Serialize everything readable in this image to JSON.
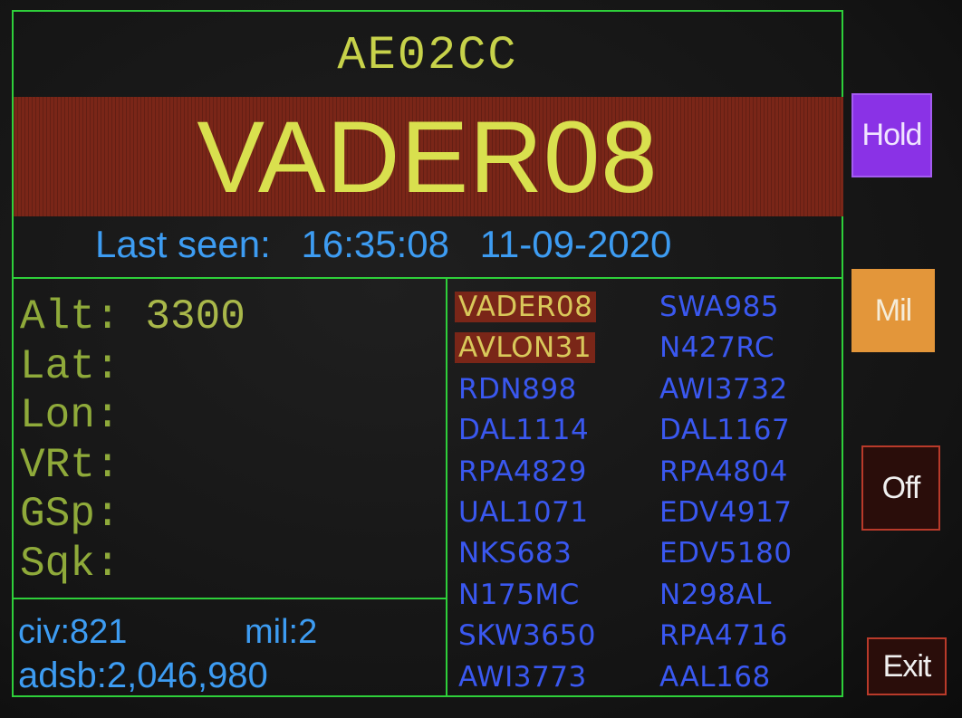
{
  "header": {
    "icao": "AE02CC",
    "callsign": "VADER08",
    "last_seen_label": "Last seen:",
    "last_seen_time": "16:35:08",
    "last_seen_date": "11-09-2020"
  },
  "stats": [
    {
      "label": "Alt:",
      "value": "3300"
    },
    {
      "label": "Lat:",
      "value": ""
    },
    {
      "label": "Lon:",
      "value": ""
    },
    {
      "label": "VRt:",
      "value": ""
    },
    {
      "label": "GSp:",
      "value": ""
    },
    {
      "label": "Sqk:",
      "value": ""
    }
  ],
  "counts": {
    "civ": "civ:821",
    "mil": "mil:2",
    "adsb": "adsb:2,046,980"
  },
  "flights": [
    "VADER08",
    "SWA985",
    "AVLON31",
    "N427RC",
    "RDN898",
    "AWI3732",
    "DAL1114",
    "DAL1167",
    "RPA4829",
    "RPA4804",
    "UAL1071",
    "EDV4917",
    "NKS683",
    "EDV5180",
    "N175MC",
    "N298AL",
    "SKW3650",
    "RPA4716",
    "AWI3773",
    "AAL168"
  ],
  "selected_flights": [
    "VADER08",
    "AVLON31"
  ],
  "buttons": {
    "hold": "Hold",
    "mil": "Mil",
    "off": "Off",
    "exit": "Exit"
  },
  "colors": {
    "frame": "#2ecf3a",
    "callsign_band": "#7a2618",
    "callsign_text": "#d9e04e",
    "info_text": "#3d9cf2",
    "list_text": "#3a58f0",
    "hold_button": "#8a32e6",
    "mil_button": "#e3963a",
    "off_exit_border": "#b93a2a"
  }
}
